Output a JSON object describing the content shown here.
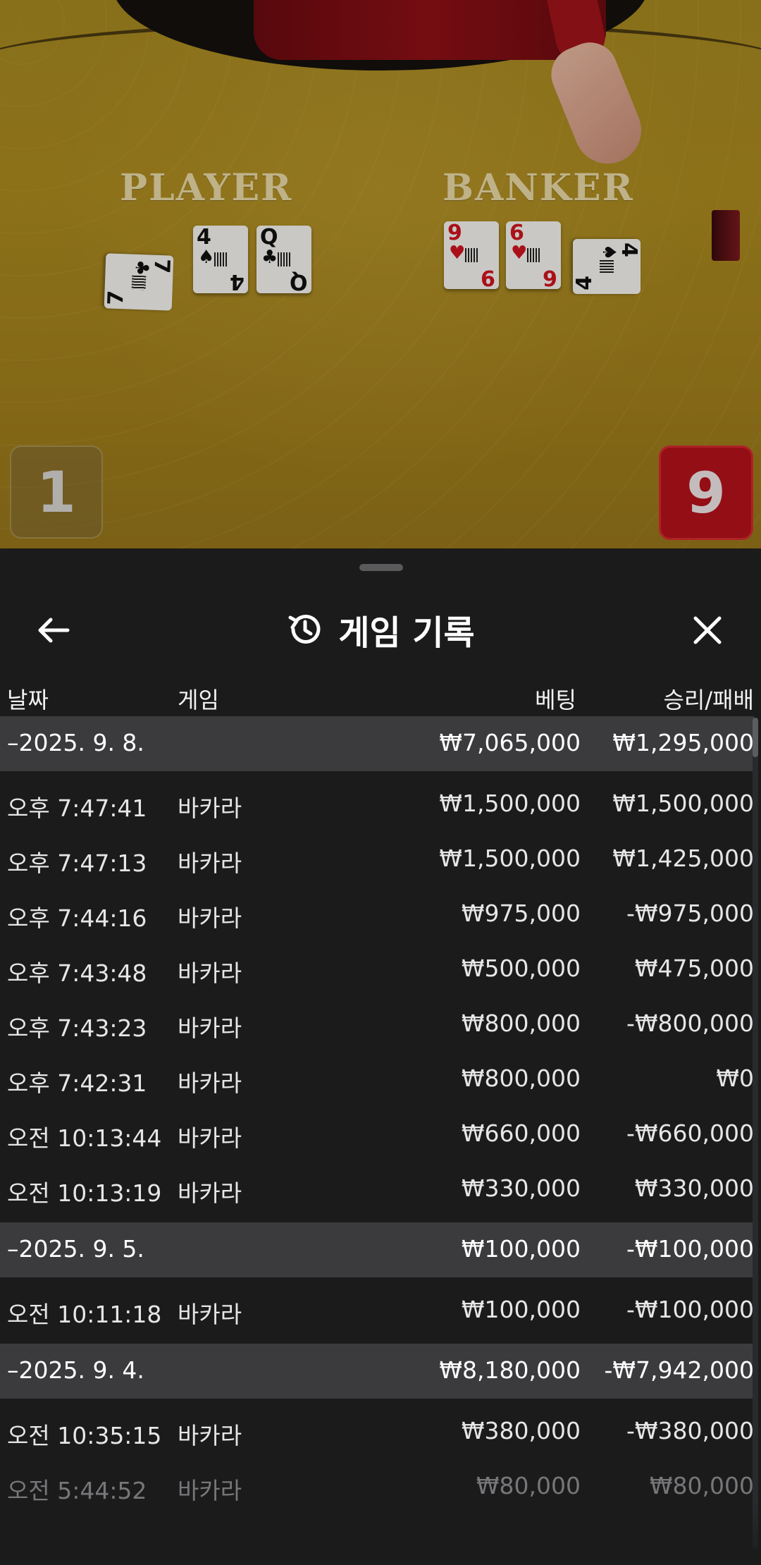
{
  "video": {
    "player_label": "PLAYER",
    "banker_label": "BANKER",
    "player_score": "1",
    "banker_score": "9",
    "player_cards": [
      {
        "rank": "7",
        "suit": "♣",
        "color": "black"
      },
      {
        "rank": "4",
        "suit": "♠",
        "color": "black"
      },
      {
        "rank": "Q",
        "suit": "♣",
        "color": "black"
      }
    ],
    "banker_cards": [
      {
        "rank": "9",
        "suit": "♥",
        "color": "red"
      },
      {
        "rank": "6",
        "suit": "♥",
        "color": "red"
      },
      {
        "rank": "4",
        "suit": "♠",
        "color": "black"
      }
    ]
  },
  "header": {
    "title": "게임 기록",
    "back_icon": "arrow-left-icon",
    "history_icon": "history-icon",
    "close_icon": "close-icon"
  },
  "columns": {
    "date": "날짜",
    "game": "게임",
    "bet": "베팅",
    "result": "승리/패배"
  },
  "groups": [
    {
      "date": "–2025. 9. 8.",
      "bet": "₩7,065,000",
      "result": "₩1,295,000",
      "items": [
        {
          "time": "오후 7:47:41",
          "game": "바카라",
          "bet": "₩1,500,000",
          "result": "₩1,500,000"
        },
        {
          "time": "오후 7:47:13",
          "game": "바카라",
          "bet": "₩1,500,000",
          "result": "₩1,425,000"
        },
        {
          "time": "오후 7:44:16",
          "game": "바카라",
          "bet": "₩975,000",
          "result": "-₩975,000"
        },
        {
          "time": "오후 7:43:48",
          "game": "바카라",
          "bet": "₩500,000",
          "result": "₩475,000"
        },
        {
          "time": "오후 7:43:23",
          "game": "바카라",
          "bet": "₩800,000",
          "result": "-₩800,000"
        },
        {
          "time": "오후 7:42:31",
          "game": "바카라",
          "bet": "₩800,000",
          "result": "₩0"
        },
        {
          "time": "오전 10:13:44",
          "game": "바카라",
          "bet": "₩660,000",
          "result": "-₩660,000"
        },
        {
          "time": "오전 10:13:19",
          "game": "바카라",
          "bet": "₩330,000",
          "result": "₩330,000"
        }
      ]
    },
    {
      "date": "–2025. 9. 5.",
      "bet": "₩100,000",
      "result": "-₩100,000",
      "items": [
        {
          "time": "오전 10:11:18",
          "game": "바카라",
          "bet": "₩100,000",
          "result": "-₩100,000"
        }
      ]
    },
    {
      "date": "–2025. 9. 4.",
      "bet": "₩8,180,000",
      "result": "-₩7,942,000",
      "items": [
        {
          "time": "오전 10:35:15",
          "game": "바카라",
          "bet": "₩380,000",
          "result": "-₩380,000"
        },
        {
          "time": "오전 5:44:52",
          "game": "바카라",
          "bet": "₩80,000",
          "result": "₩80,000"
        }
      ]
    }
  ],
  "colors": {
    "sheet_bg": "#1b1b1c",
    "group_row_bg": "#3b3b3d",
    "banker_score_bg": "#b5121b",
    "felt": "#a78820"
  }
}
